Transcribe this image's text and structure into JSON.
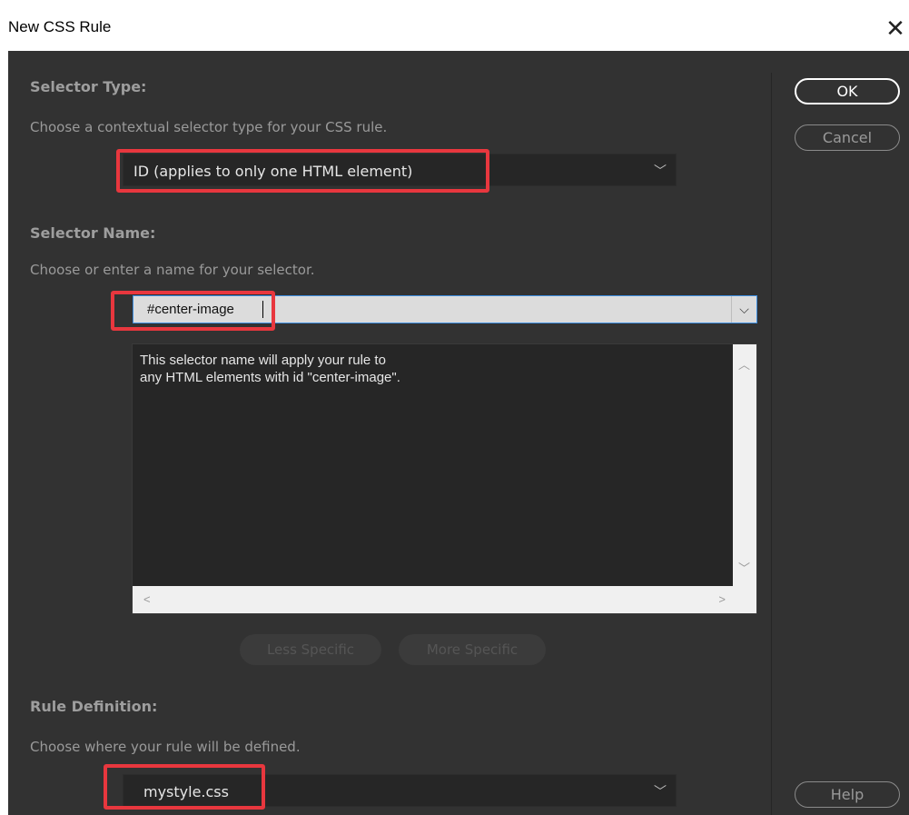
{
  "window": {
    "title": "New CSS Rule",
    "close_glyph": "✕"
  },
  "selector_type": {
    "heading": "Selector Type:",
    "description": "Choose a contextual selector type for your CSS rule.",
    "value": "ID (applies to only one HTML element)"
  },
  "selector_name": {
    "heading": "Selector Name:",
    "description": "Choose or enter a name for your selector.",
    "value": "#center-image",
    "info_lines": [
      "This selector name will apply your rule to",
      "any HTML elements with id \"center-image\"."
    ],
    "less_specific": "Less Specific",
    "more_specific": "More Specific"
  },
  "rule_definition": {
    "heading": "Rule Definition:",
    "description": "Choose where your rule will be defined.",
    "value": "mystyle.css"
  },
  "buttons": {
    "ok": "OK",
    "cancel": "Cancel",
    "help": "Help"
  },
  "icons": {
    "chevron": "﹀",
    "chevron_small": "⌵",
    "scroll_up": "︿",
    "scroll_down": "﹀",
    "scroll_left": "<",
    "scroll_right": ">"
  },
  "colors": {
    "panel_bg": "#323232",
    "field_bg": "#262626",
    "highlight": "#e8373e",
    "focus": "#3d8ee0"
  }
}
